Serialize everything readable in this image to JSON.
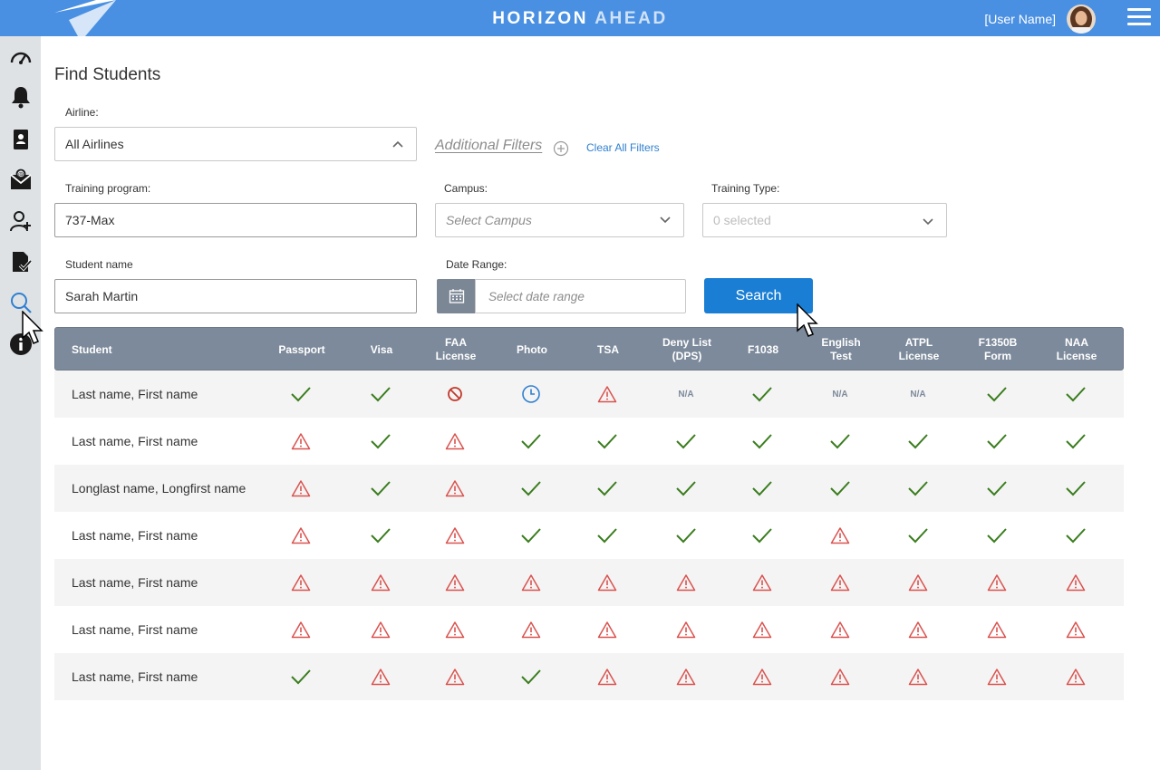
{
  "header": {
    "brand_word1": "HORIZON",
    "brand_word2": "AHEAD",
    "user_name": "[User Name]",
    "bar_color": "#4a90e2"
  },
  "sidebar": {
    "items": [
      {
        "name": "dashboard",
        "icon": "speedometer-icon"
      },
      {
        "name": "notifications",
        "icon": "bell-icon"
      },
      {
        "name": "contacts",
        "icon": "contact-book-icon"
      },
      {
        "name": "messages",
        "icon": "mail-icon"
      },
      {
        "name": "add-user",
        "icon": "add-user-icon"
      },
      {
        "name": "documents",
        "icon": "document-check-icon"
      },
      {
        "name": "find-students",
        "icon": "search-icon",
        "active": true
      },
      {
        "name": "info",
        "icon": "info-icon"
      }
    ]
  },
  "page": {
    "title": "Find Students"
  },
  "filters": {
    "airline_label": "Airline:",
    "airline_value": "All Airlines",
    "additional_filters": "Additional Filters",
    "clear_all": "Clear All Filters",
    "program_label": "Training program:",
    "program_value": "737-Max",
    "campus_label": "Campus:",
    "campus_placeholder": "Select Campus",
    "type_label": "Training Type:",
    "type_placeholder": "0 selected",
    "student_label": "Student name",
    "student_value": "Sarah Martin",
    "date_label": "Date Range:",
    "date_placeholder": "Select date range",
    "search_button": "Search"
  },
  "table": {
    "columns": [
      {
        "key": "student",
        "label": "Student"
      },
      {
        "key": "passport",
        "label": "Passport"
      },
      {
        "key": "visa",
        "label": "Visa"
      },
      {
        "key": "faa",
        "label": "FAA\nLicense"
      },
      {
        "key": "photo",
        "label": "Photo"
      },
      {
        "key": "tsa",
        "label": "TSA"
      },
      {
        "key": "deny",
        "label": "Deny List\n(DPS)"
      },
      {
        "key": "f1038",
        "label": "F1038"
      },
      {
        "key": "english",
        "label": "English\nTest"
      },
      {
        "key": "atpl",
        "label": "ATPL\nLicense"
      },
      {
        "key": "f1350b",
        "label": "F1350B\nForm"
      },
      {
        "key": "naa",
        "label": "NAA\nLicense"
      }
    ],
    "na_label": "N/A",
    "rows": [
      {
        "name": "Last name, First name",
        "status": [
          "check",
          "check",
          "blocked",
          "pending",
          "warning",
          "na",
          "check",
          "na",
          "na",
          "check",
          "check"
        ]
      },
      {
        "name": "Last name, First name",
        "status": [
          "warning",
          "check",
          "warning",
          "check",
          "check",
          "check",
          "check",
          "check",
          "check",
          "check",
          "check"
        ]
      },
      {
        "name": "Longlast name, Longfirst name",
        "status": [
          "warning",
          "check",
          "warning",
          "check",
          "check",
          "check",
          "check",
          "check",
          "check",
          "check",
          "check"
        ]
      },
      {
        "name": "Last name, First name",
        "status": [
          "warning",
          "check",
          "warning",
          "check",
          "check",
          "check",
          "check",
          "warning",
          "check",
          "check",
          "check"
        ]
      },
      {
        "name": "Last name, First name",
        "status": [
          "warning",
          "warning",
          "warning",
          "warning",
          "warning",
          "warning",
          "warning",
          "warning",
          "warning",
          "warning",
          "warning"
        ]
      },
      {
        "name": "Last name, First name",
        "status": [
          "warning",
          "warning",
          "warning",
          "warning",
          "warning",
          "warning",
          "warning",
          "warning",
          "warning",
          "warning",
          "warning"
        ]
      },
      {
        "name": "Last name, First name",
        "status": [
          "check",
          "warning",
          "warning",
          "check",
          "warning",
          "warning",
          "warning",
          "warning",
          "warning",
          "warning",
          "warning"
        ]
      }
    ],
    "status_colors": {
      "check": "#3a7d1e",
      "warning": "#d9534f",
      "blocked": "#c0392b",
      "pending": "#2f80d0",
      "na": "#7d8a9b"
    }
  }
}
